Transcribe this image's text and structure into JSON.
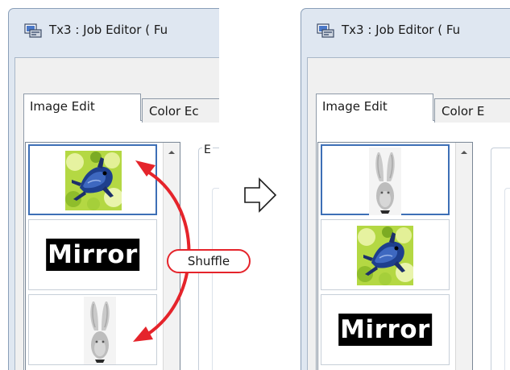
{
  "window": {
    "title": "Tx3 : Job Editor ( Fu",
    "title_right": "Tx3 : Job Editor ( Fu"
  },
  "tabs": {
    "active": "Image Edit",
    "inactive_left": "Color Ec",
    "inactive_right": "Color E"
  },
  "group_box": {
    "letter": "E"
  },
  "list_items": {
    "before": [
      "frog-image",
      "mirror-text-image",
      "rabbit-image"
    ],
    "after": [
      "rabbit-image",
      "frog-image",
      "mirror-text-image"
    ]
  },
  "mirror_label": "Mirror",
  "annotation": {
    "label": "Shuffle"
  },
  "icons": [
    "app-icon",
    "scroll-up-icon",
    "right-arrow-icon"
  ],
  "colors": {
    "accent": "#e5242b",
    "selection": "#3d6fb6"
  }
}
